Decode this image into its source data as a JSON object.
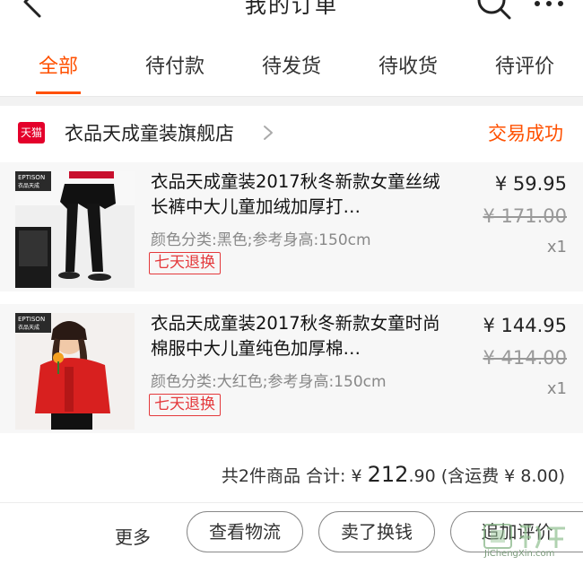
{
  "header": {
    "title": "我的订单"
  },
  "tabs": [
    {
      "label": "全部",
      "active": true
    },
    {
      "label": "待付款",
      "active": false
    },
    {
      "label": "待发货",
      "active": false
    },
    {
      "label": "待收货",
      "active": false
    },
    {
      "label": "待评价",
      "active": false
    }
  ],
  "order": {
    "shop_badge": "天猫",
    "shop_name": "衣品天成童装旗舰店",
    "status": "交易成功",
    "items": [
      {
        "title": "衣品天成童装2017秋冬新款女童丝绒长裤中大儿童加绒加厚打…",
        "sku": "颜色分类:黑色;参考身高:150cm",
        "tag": "七天退换",
        "price": "¥ 59.95",
        "original_price": "¥ 171.00",
        "quantity": "x1",
        "thumb_brand": "EPTISON",
        "thumb_brand_sub": "衣品天成"
      },
      {
        "title": "衣品天成童装2017秋冬新款女童时尚棉服中大儿童纯色加厚棉…",
        "sku": "颜色分类:大红色;参考身高:150cm",
        "tag": "七天退换",
        "price": "¥ 144.95",
        "original_price": "¥ 414.00",
        "quantity": "x1",
        "thumb_brand": "EPTISON",
        "thumb_brand_sub": "衣品天成"
      }
    ],
    "summary": {
      "count_text": "共2件商品 合计: ¥ ",
      "total_int": "212",
      "total_dec": ".90",
      "shipping": " (含运费 ¥ 8.00)"
    },
    "actions": {
      "more": "更多",
      "logistics": "查看物流",
      "resell": "卖了换钱",
      "review": "追加评价"
    }
  },
  "watermark": {
    "text": "JiChengXin.com"
  },
  "colors": {
    "accent": "#ff5000",
    "tag_red": "#e4393c",
    "tmall_red": "#e4002b"
  }
}
